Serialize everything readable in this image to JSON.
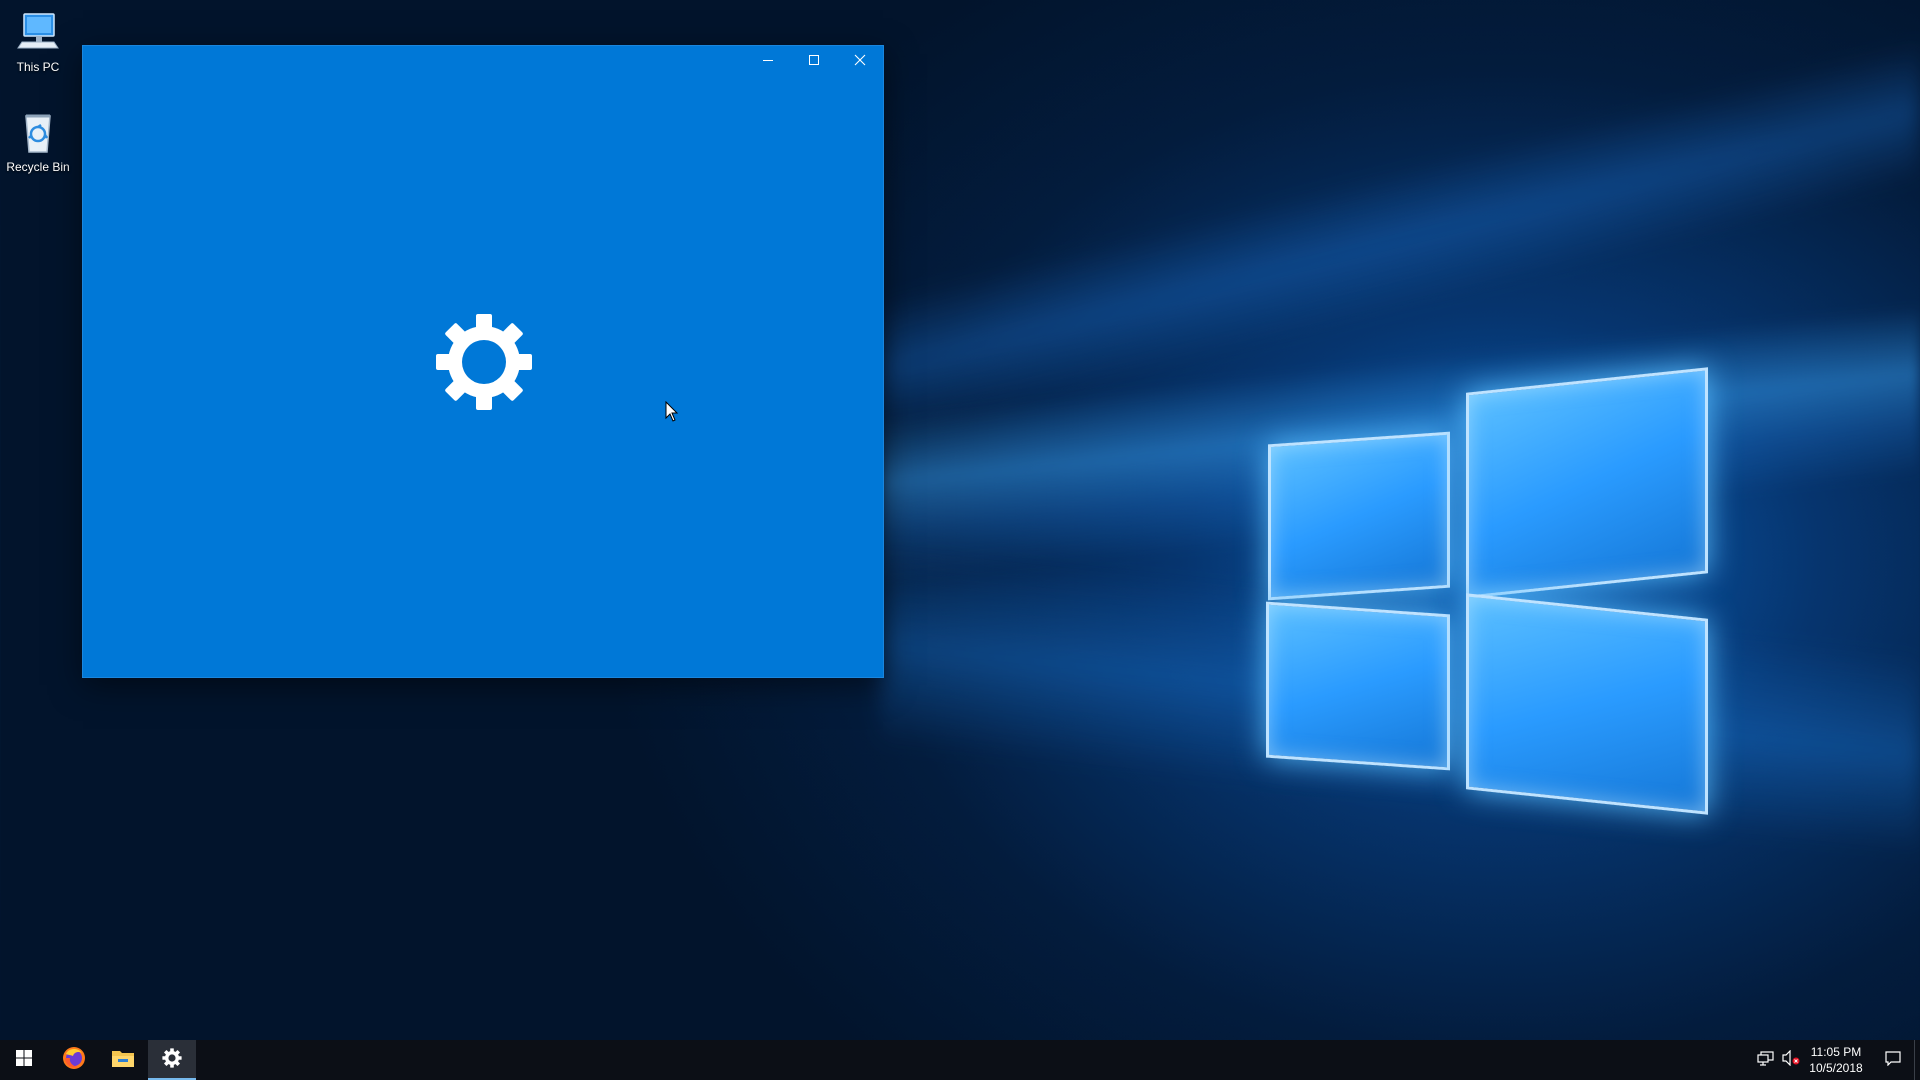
{
  "desktop": {
    "icons": [
      {
        "label": "This PC",
        "icon": "this-pc-icon"
      },
      {
        "label": "Recycle Bin",
        "icon": "recycle-bin-icon"
      }
    ]
  },
  "window": {
    "app": "Settings",
    "state": "splash-loading",
    "background_color": "#0078d7",
    "splash_icon": "gear-icon",
    "controls": {
      "minimize": "minimize-icon",
      "maximize": "maximize-icon",
      "close": "close-icon"
    }
  },
  "taskbar": {
    "pinned": [
      {
        "name": "start",
        "icon": "windows-logo-icon"
      },
      {
        "name": "firefox",
        "icon": "firefox-icon"
      },
      {
        "name": "file-explorer",
        "icon": "folder-icon"
      },
      {
        "name": "settings",
        "icon": "gear-icon",
        "active": true
      }
    ],
    "tray": {
      "network_icon": "network-icon",
      "volume_icon": "volume-muted-icon",
      "time": "11:05 PM",
      "date": "10/5/2018",
      "notifications_icon": "action-center-icon"
    }
  },
  "colors": {
    "accent": "#0078d7",
    "taskbar": "#0c0f16",
    "active_indicator": "#76b9ed"
  }
}
